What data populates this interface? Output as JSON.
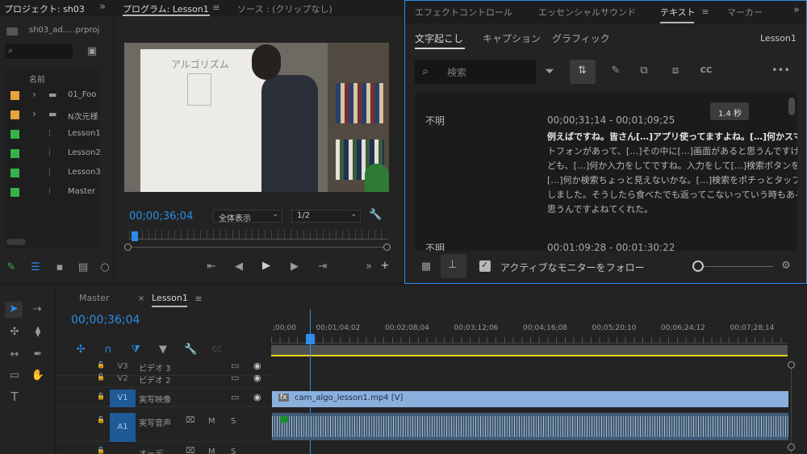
{
  "project": {
    "title": "プロジェクト: sh03",
    "file_name": "sh03_ad.....prproj",
    "column_name": "名前",
    "items": [
      {
        "label": "01_Foo",
        "color": "#e8a33b",
        "type": "folder"
      },
      {
        "label": "N次元様",
        "color": "#e8a33b",
        "type": "folder"
      },
      {
        "label": "Lesson1",
        "color": "#35b24a",
        "type": "sequence"
      },
      {
        "label": "Lesson2",
        "color": "#35b24a",
        "type": "sequence"
      },
      {
        "label": "Lesson3",
        "color": "#35b24a",
        "type": "sequence"
      },
      {
        "label": "Master",
        "color": "#35b24a",
        "type": "sequence"
      }
    ]
  },
  "program": {
    "tab_program": "プログラム: Lesson1",
    "tab_source": "ソース : (クリップなし)",
    "timecode": "00;00;36;04",
    "zoom": "全体表示",
    "resolution": "1/2",
    "whiteboard_text": "アルゴリズム"
  },
  "right_panel": {
    "tabs": [
      "エフェクトコントロール",
      "エッセンシャルサウンド",
      "テキスト",
      "マーカー"
    ],
    "subtabs": [
      "文字起こし",
      "キャプション",
      "グラフィック"
    ],
    "sequence": "Lesson1",
    "search_placeholder": "検索",
    "tooltip": "1.4 秒",
    "speaker": "不明",
    "time_range": "00;00;31;14 - 00;01;09;25",
    "lines": [
      "例えばですね。皆さん[…]アプリ使ってますよね。[…]何かスマー",
      "トフォンがあって、[…]その中に[…]画面があると思うんですけれ",
      "ども、[…]何か入力をしてですね。入力をして[…]検索ボタンを",
      "[…]何か検索ちょっと見えないかな。[…]検索をポチっとタップ",
      "しました。そうしたら食べたでも返ってこないっていう時もあると",
      "思うんですよねてくれた。"
    ],
    "speaker2": "不明",
    "time_range2": "00;01;09;28 - 00;01;30;22",
    "follow_label": "アクティブなモニターをフォロー"
  },
  "timeline": {
    "tab_master": "Master",
    "tab_lesson": "Lesson1",
    "timecode": "00;00;36;04",
    "ruler": [
      ";00;00",
      "00;01;04;02",
      "00;02;08;04",
      "00;03;12;06",
      "00;04;16;08",
      "00;05;20;10",
      "00;06;24;12",
      "00;07;28;14"
    ],
    "tracks": [
      {
        "id": "V3",
        "name": "ビデオ 3"
      },
      {
        "id": "V2",
        "name": "ビデオ 2"
      },
      {
        "id": "V1",
        "name": "実写映像"
      },
      {
        "id": "A1",
        "name": "実写音声"
      },
      {
        "id": "A2",
        "name": "オーデ"
      }
    ],
    "clip_name": "cam_algo_lesson1.mp4 [V]",
    "fx_label": "fx",
    "m_label": "M",
    "s_label": "S"
  }
}
